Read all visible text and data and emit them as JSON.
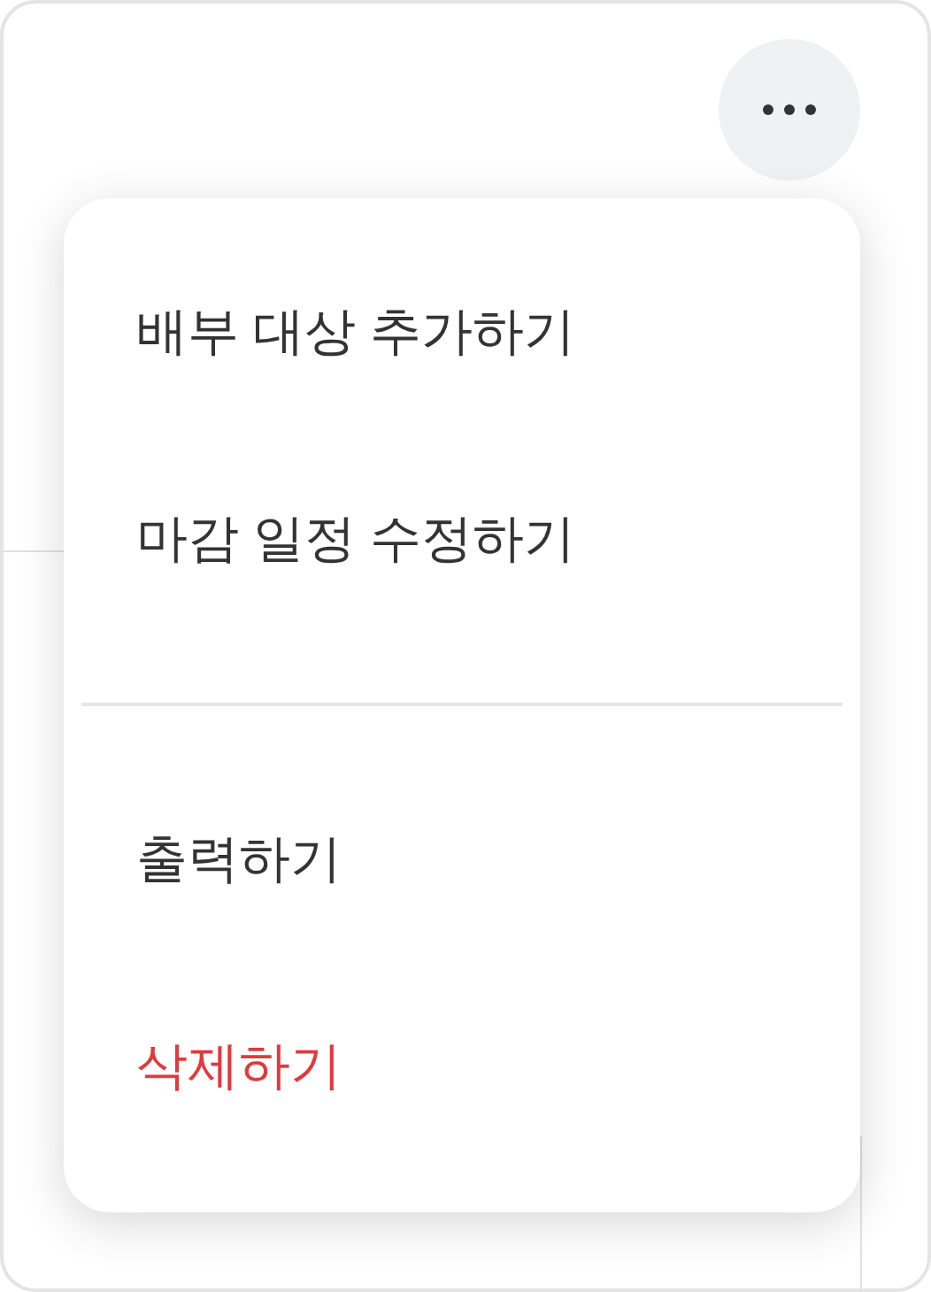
{
  "menu": {
    "sections": [
      {
        "items": [
          {
            "label": "배부 대상 추가하기",
            "kind": "normal"
          },
          {
            "label": "마감 일정 수정하기",
            "kind": "normal"
          }
        ]
      },
      {
        "items": [
          {
            "label": "출력하기",
            "kind": "normal"
          },
          {
            "label": "삭제하기",
            "kind": "danger"
          }
        ]
      }
    ]
  }
}
